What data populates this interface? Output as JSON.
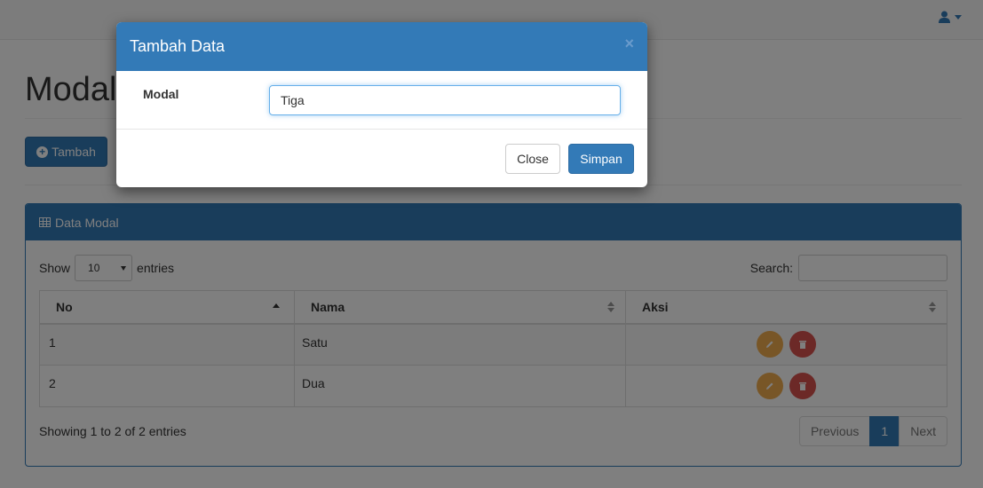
{
  "navbar": {
    "user_icon": "user-icon"
  },
  "page": {
    "title": "Modal",
    "add_button_label": "Tambah"
  },
  "panel": {
    "title": "Data Modal",
    "show_label": "Show",
    "entries_label": "entries",
    "page_length": "10",
    "search_label": "Search:",
    "search_value": "",
    "columns": [
      "No",
      "Nama",
      "Aksi"
    ],
    "rows": [
      {
        "no": "1",
        "nama": "Satu"
      },
      {
        "no": "2",
        "nama": "Dua"
      }
    ],
    "info": "Showing 1 to 2 of 2 entries",
    "pagination": {
      "previous": "Previous",
      "current": "1",
      "next": "Next"
    }
  },
  "modal": {
    "title": "Tambah Data",
    "close_symbol": "×",
    "field_label": "Modal",
    "field_value": "Tiga",
    "close_label": "Close",
    "save_label": "Simpan"
  },
  "colors": {
    "primary": "#337ab7",
    "warning": "#f0ad4e",
    "danger": "#d9534f"
  }
}
